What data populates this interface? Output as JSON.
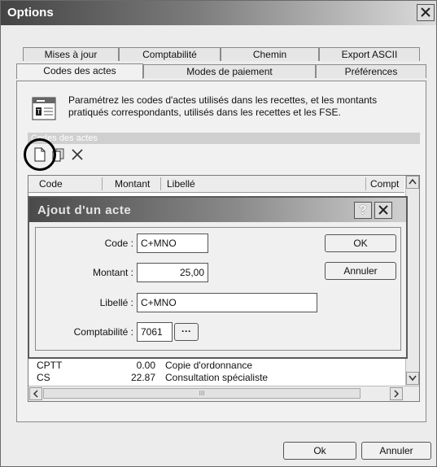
{
  "window": {
    "title": "Options"
  },
  "tabs": {
    "row1": [
      "Mises à jour",
      "Comptabilité",
      "Chemin",
      "Export ASCII"
    ],
    "row2": [
      "Codes des actes",
      "Modes de paiement",
      "Préférences"
    ],
    "active": "Codes des actes"
  },
  "panel": {
    "description_line1": "Paramétrez les codes d'actes utilisés dans les recettes, et les montants",
    "description_line2": "pratiqués correspondants, utilisés dans les recettes et les FSE.",
    "section_title": "Codes des actes"
  },
  "grid": {
    "columns": [
      "Code",
      "Montant",
      "Libellé",
      "Compt"
    ],
    "rows": [
      {
        "code": "CPTT",
        "montant": "0.00",
        "libelle": "Copie d'ordonnance"
      },
      {
        "code": "CS",
        "montant": "22.87",
        "libelle": "Consultation spécialiste"
      }
    ],
    "hscroll_thumb": "III"
  },
  "dialog": {
    "title": "Ajout d'un acte",
    "help_label": "?",
    "code_label": "Code :",
    "code_value": "C+MNO",
    "montant_label": "Montant :",
    "montant_value": "25,00",
    "libelle_label": "Libellé :",
    "libelle_value": "C+MNO",
    "comptabilite_label": "Comptabilité :",
    "comptabilite_value": "7061",
    "browse_label": "···",
    "ok_label": "OK",
    "cancel_label": "Annuler"
  },
  "footer": {
    "ok_label": "Ok",
    "cancel_label": "Annuler"
  },
  "colors": {
    "title_dark": "#444444",
    "accent_circle": "#000000"
  }
}
